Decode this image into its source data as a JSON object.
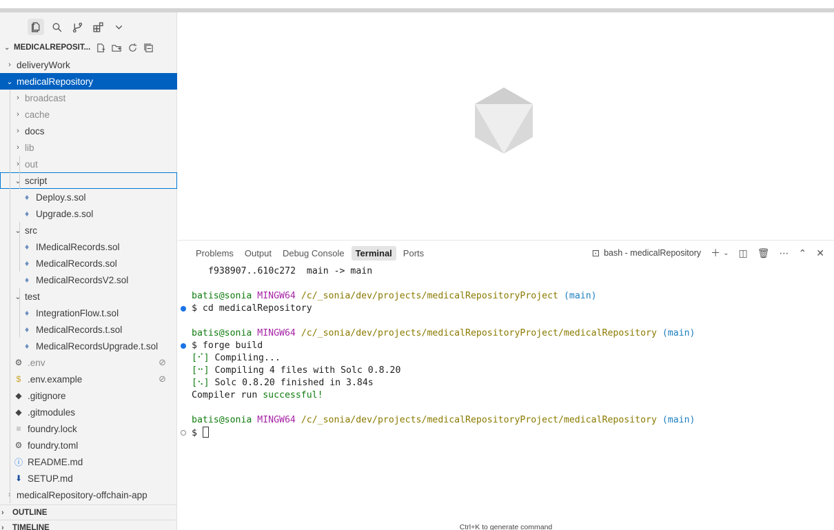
{
  "activity_bar": {
    "icons": [
      "files-icon",
      "search-icon",
      "source-control-icon",
      "extensions-icon",
      "chevron-down-icon"
    ]
  },
  "explorer": {
    "root_label": "MEDICALREPOSIT...",
    "header_actions": [
      "new-file-icon",
      "new-folder-icon",
      "refresh-icon",
      "collapse-all-icon"
    ],
    "items": [
      {
        "label": "deliveryWork",
        "type": "folder",
        "expanded": false
      },
      {
        "label": "medicalRepository",
        "type": "folder",
        "expanded": true,
        "selected": true
      },
      {
        "label": "broadcast",
        "type": "folder",
        "expanded": false,
        "dim": true
      },
      {
        "label": "cache",
        "type": "folder",
        "expanded": false,
        "dim": true
      },
      {
        "label": "docs",
        "type": "folder",
        "expanded": false
      },
      {
        "label": "lib",
        "type": "folder",
        "expanded": false,
        "dim": true
      },
      {
        "label": "out",
        "type": "folder",
        "expanded": false,
        "dim": true
      },
      {
        "label": "script",
        "type": "folder",
        "expanded": true,
        "focused": true
      },
      {
        "label": "Deploy.s.sol",
        "type": "sol"
      },
      {
        "label": "Upgrade.s.sol",
        "type": "sol"
      },
      {
        "label": "src",
        "type": "folder",
        "expanded": true
      },
      {
        "label": "IMedicalRecords.sol",
        "type": "sol"
      },
      {
        "label": "MedicalRecords.sol",
        "type": "sol"
      },
      {
        "label": "MedicalRecordsV2.sol",
        "type": "sol"
      },
      {
        "label": "test",
        "type": "folder",
        "expanded": true
      },
      {
        "label": "IntegrationFlow.t.sol",
        "type": "sol"
      },
      {
        "label": "MedicalRecords.t.sol",
        "type": "sol"
      },
      {
        "label": "MedicalRecordsUpgrade.t.sol",
        "type": "sol"
      },
      {
        "label": ".env",
        "type": "gear",
        "dim": true,
        "badge": "⊘"
      },
      {
        "label": ".env.example",
        "type": "dollar",
        "badge": "⊘"
      },
      {
        "label": ".gitignore",
        "type": "git"
      },
      {
        "label": ".gitmodules",
        "type": "git"
      },
      {
        "label": "foundry.lock",
        "type": "lines"
      },
      {
        "label": "foundry.toml",
        "type": "gear"
      },
      {
        "label": "README.md",
        "type": "info"
      },
      {
        "label": "SETUP.md",
        "type": "down"
      },
      {
        "label": "medicalRepository-offchain-app",
        "type": "folder",
        "expanded": false
      }
    ]
  },
  "sections": {
    "outline": "OUTLINE",
    "timeline": "TIMELINE"
  },
  "panel": {
    "tabs": [
      "Problems",
      "Output",
      "Debug Console",
      "Terminal",
      "Ports"
    ],
    "active_tab": "Terminal",
    "terminal_name": "bash - medicalRepository",
    "actions": [
      "plus-icon",
      "chevron-down-icon",
      "split-icon",
      "trash-icon",
      "more-icon",
      "maximize-icon",
      "close-icon"
    ]
  },
  "terminal": {
    "line1": "f938907..610c272  main -> main",
    "prompt1": {
      "user": "batis@sonia",
      "host": "MINGW64",
      "path": "/c/_sonia/dev/projects/medicalRepositoryProject",
      "branch": "(main)"
    },
    "cmd1": "$ cd medicalRepository",
    "prompt2": {
      "user": "batis@sonia",
      "host": "MINGW64",
      "path": "/c/_sonia/dev/projects/medicalRepositoryProject/medicalRepository",
      "branch": "(main)"
    },
    "cmd2": "$ forge build",
    "out1_spin": "[⠊]",
    "out1": " Compiling...",
    "out2_spin": "[⠒]",
    "out2": " Compiling 4 files with Solc 0.8.20",
    "out3_spin": "[⠢]",
    "out3": " Solc 0.8.20 finished in 3.84s",
    "out4_a": "Compiler run ",
    "out4_b": "successful!",
    "prompt3": {
      "user": "batis@sonia",
      "host": "MINGW64",
      "path": "/c/_sonia/dev/projects/medicalRepositoryProject/medicalRepository",
      "branch": "(main)"
    },
    "cmd3": "$ "
  },
  "hint": "Ctrl+K to generate command",
  "colors": {
    "selection": "#0060c0",
    "focus_border": "#0078d4",
    "sol_icon": "#6c8ebf"
  }
}
